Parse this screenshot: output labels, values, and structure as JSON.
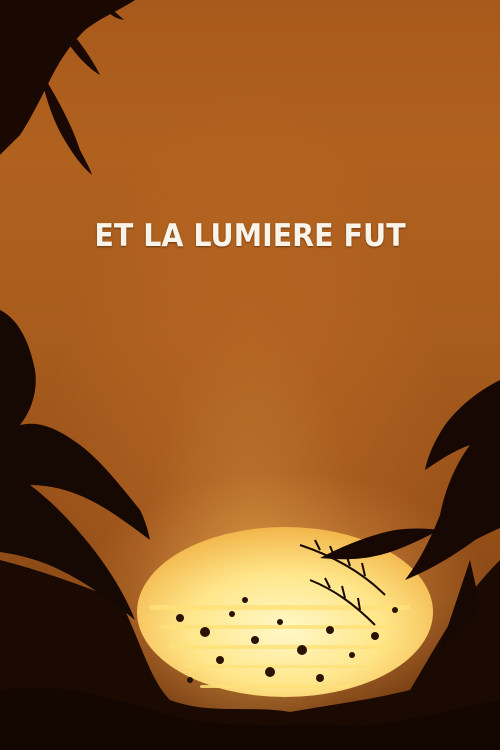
{
  "title": {
    "text": "ET LA LUMIERE FUT"
  },
  "colors": {
    "sky": "#a85a1c",
    "sun": "#fff3b0",
    "silhouette": "#1a0a02",
    "title_text": "#f8f4ea"
  }
}
